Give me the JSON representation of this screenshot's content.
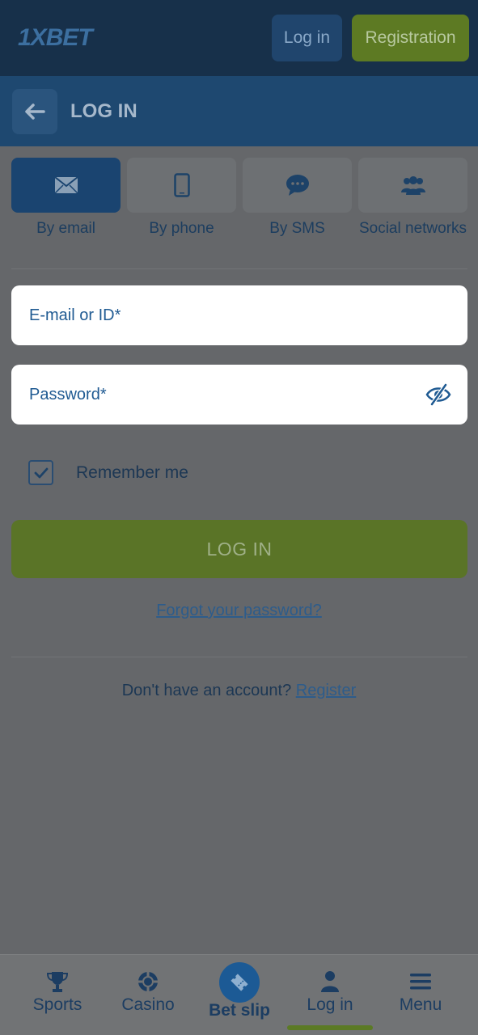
{
  "header": {
    "logo": "1XBET",
    "login_label": "Log in",
    "register_label": "Registration"
  },
  "subheader": {
    "title": "LOG IN"
  },
  "tabs": [
    {
      "label": "By email",
      "icon": "envelope-icon",
      "active": true
    },
    {
      "label": "By phone",
      "icon": "phone-icon",
      "active": false
    },
    {
      "label": "By SMS",
      "icon": "chat-icon",
      "active": false
    },
    {
      "label": "Social networks",
      "icon": "users-icon",
      "active": false
    }
  ],
  "form": {
    "email_placeholder": "E-mail or ID*",
    "password_placeholder": "Password*",
    "remember_label": "Remember me",
    "remember_checked": true,
    "submit_label": "LOG IN",
    "forgot_label": "Forgot your password?",
    "signup_prompt": "Don't have an account?",
    "signup_link": "Register"
  },
  "bottom_nav": [
    {
      "label": "Sports",
      "icon": "trophy-icon"
    },
    {
      "label": "Casino",
      "icon": "casino-chip-icon"
    },
    {
      "label": "Bet slip",
      "icon": "ticket-icon"
    },
    {
      "label": "Log in",
      "icon": "user-icon",
      "active": true
    },
    {
      "label": "Menu",
      "icon": "menu-icon"
    }
  ],
  "colors": {
    "brand_dark": "#17304a",
    "brand_blue": "#1e4870",
    "accent_green": "#5d7a23",
    "overlay_gray": "#65676a"
  }
}
